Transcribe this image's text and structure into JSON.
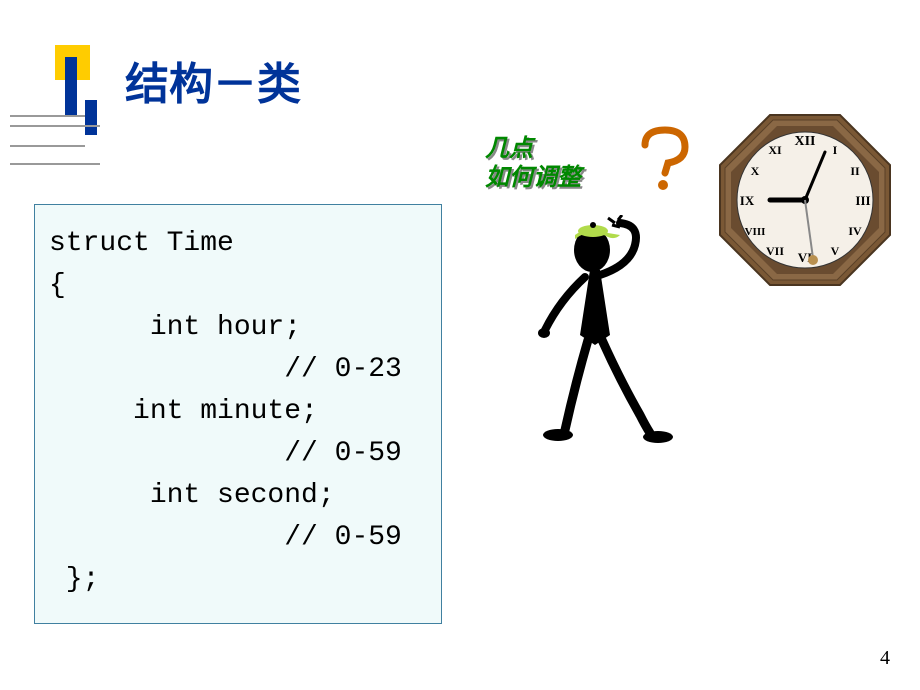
{
  "title": "结构－类",
  "question": {
    "line1": "几点",
    "line2": "如何调整"
  },
  "code": {
    "line1": "struct Time",
    "line2": "{",
    "line3": "      int hour;",
    "line4": "              // 0-23",
    "line5": "     int minute;",
    "line6": "              // 0-59",
    "line7": "      int second;",
    "line8": "              // 0-59",
    "line9": " };"
  },
  "page_number": "4",
  "clock": {
    "numerals": [
      "XII",
      "I",
      "II",
      "III",
      "IV",
      "V",
      "VI",
      "VII",
      "VIII",
      "IX",
      "X",
      "XI"
    ]
  }
}
